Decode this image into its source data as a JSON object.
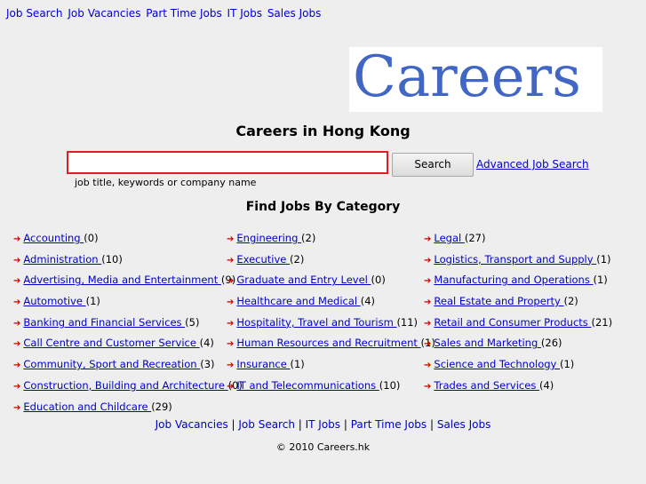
{
  "topnav": [
    "Job Search",
    "Job Vacancies",
    "Part Time Jobs",
    "IT Jobs",
    "Sales Jobs"
  ],
  "logo": "Careers",
  "title": "Careers in Hong Kong",
  "search": {
    "value": "",
    "button": "Search",
    "advanced": "Advanced Job Search",
    "hint": "job title, keywords or company name"
  },
  "section_title": "Find Jobs By Category",
  "columns": [
    [
      {
        "name": "Accounting ",
        "count": "(0)"
      },
      {
        "name": "Administration ",
        "count": "(10)"
      },
      {
        "name": "Advertising, Media and Entertainment ",
        "count": "(9)"
      },
      {
        "name": "Automotive ",
        "count": "(1)"
      },
      {
        "name": "Banking and Financial Services ",
        "count": "(5)"
      },
      {
        "name": "Call Centre and Customer Service ",
        "count": "(4)"
      },
      {
        "name": "Community, Sport and Recreation ",
        "count": "(3)"
      },
      {
        "name": "Construction, Building and Architecture ",
        "count": "(0)"
      },
      {
        "name": "Education and Childcare ",
        "count": "(29)"
      }
    ],
    [
      {
        "name": "Engineering ",
        "count": "(2)"
      },
      {
        "name": "Executive ",
        "count": "(2)"
      },
      {
        "name": "Graduate and Entry Level ",
        "count": "(0)"
      },
      {
        "name": "Healthcare and Medical ",
        "count": "(4)"
      },
      {
        "name": "Hospitality, Travel and Tourism ",
        "count": "(11)"
      },
      {
        "name": "Human Resources and Recruitment ",
        "count": "(1)"
      },
      {
        "name": "Insurance ",
        "count": "(1)"
      },
      {
        "name": "IT and Telecommunications ",
        "count": "(10)"
      }
    ],
    [
      {
        "name": "Legal ",
        "count": "(27)"
      },
      {
        "name": "Logistics, Transport and Supply ",
        "count": "(1)"
      },
      {
        "name": "Manufacturing and Operations ",
        "count": "(1)"
      },
      {
        "name": "Real Estate and Property ",
        "count": "(2)"
      },
      {
        "name": "Retail and Consumer Products ",
        "count": "(21)"
      },
      {
        "name": "Sales and Marketing ",
        "count": "(26)"
      },
      {
        "name": "Science and Technology ",
        "count": "(1)"
      },
      {
        "name": "Trades and Services ",
        "count": "(4)"
      }
    ]
  ],
  "footer_links": [
    "Job Vacancies",
    "Job Search",
    "IT Jobs",
    "Part Time Jobs",
    "Sales Jobs"
  ],
  "footer_separator": " | ",
  "copyright": "© 2010 Careers.hk",
  "arrow_glyph": "➔"
}
